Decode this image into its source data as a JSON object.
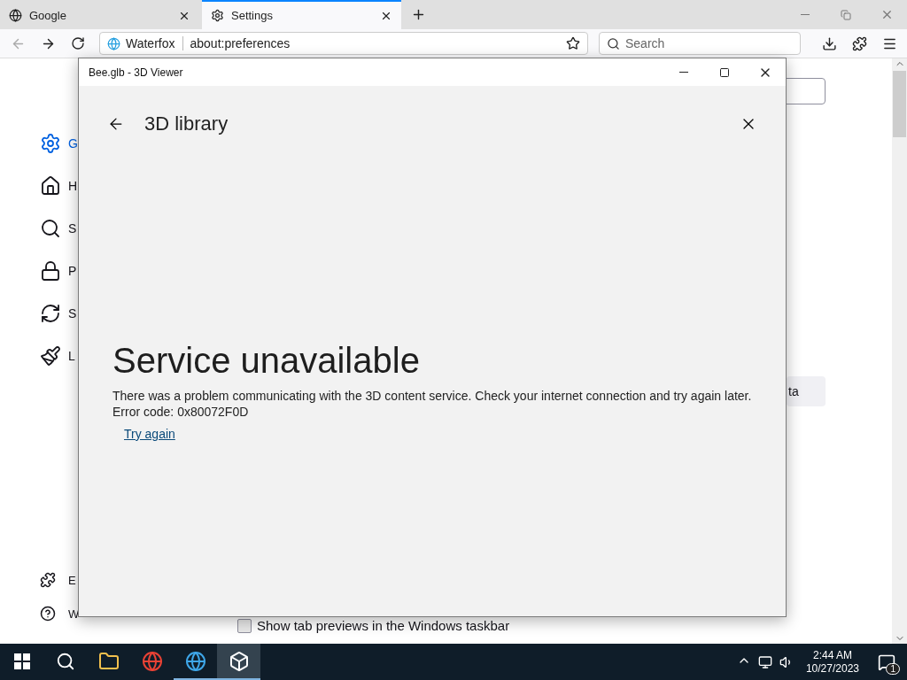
{
  "browser": {
    "tabs": [
      {
        "label": "Google",
        "selected": false
      },
      {
        "label": "Settings",
        "selected": true
      }
    ],
    "back": {
      "disabled": true
    },
    "address": {
      "identity": "Waterfox",
      "url": "about:preferences"
    },
    "search": {
      "placeholder": "Search"
    }
  },
  "sidebar": {
    "items": [
      {
        "label": "G",
        "selected": true
      },
      {
        "label": "H",
        "selected": false
      },
      {
        "label": "S",
        "selected": false
      },
      {
        "label": "P",
        "selected": false
      },
      {
        "label": "S",
        "selected": false
      },
      {
        "label": "L",
        "selected": false
      }
    ],
    "footer": [
      {
        "label": "E"
      },
      {
        "label": "W"
      }
    ]
  },
  "content": {
    "button_fragment": "ta",
    "checkbox": {
      "label": "Show tab previews in the Windows taskbar",
      "checked": false
    }
  },
  "viewer": {
    "title": "Bee.glb - 3D Viewer",
    "page_title": "3D library",
    "heading": "Service unavailable",
    "message": "There was a problem communicating with the 3D content service. Check your internet connection and try again later.",
    "error": "Error code: 0x80072F0D",
    "link": "Try again"
  },
  "taskbar": {
    "apps": [
      {
        "running": false,
        "selected": false
      },
      {
        "running": false,
        "selected": false
      },
      {
        "running": true,
        "selected": false
      },
      {
        "running": true,
        "selected": true
      }
    ],
    "clock": {
      "time": "2:44 AM",
      "date": "10/27/2023"
    },
    "notifications": {
      "count": "1"
    }
  }
}
